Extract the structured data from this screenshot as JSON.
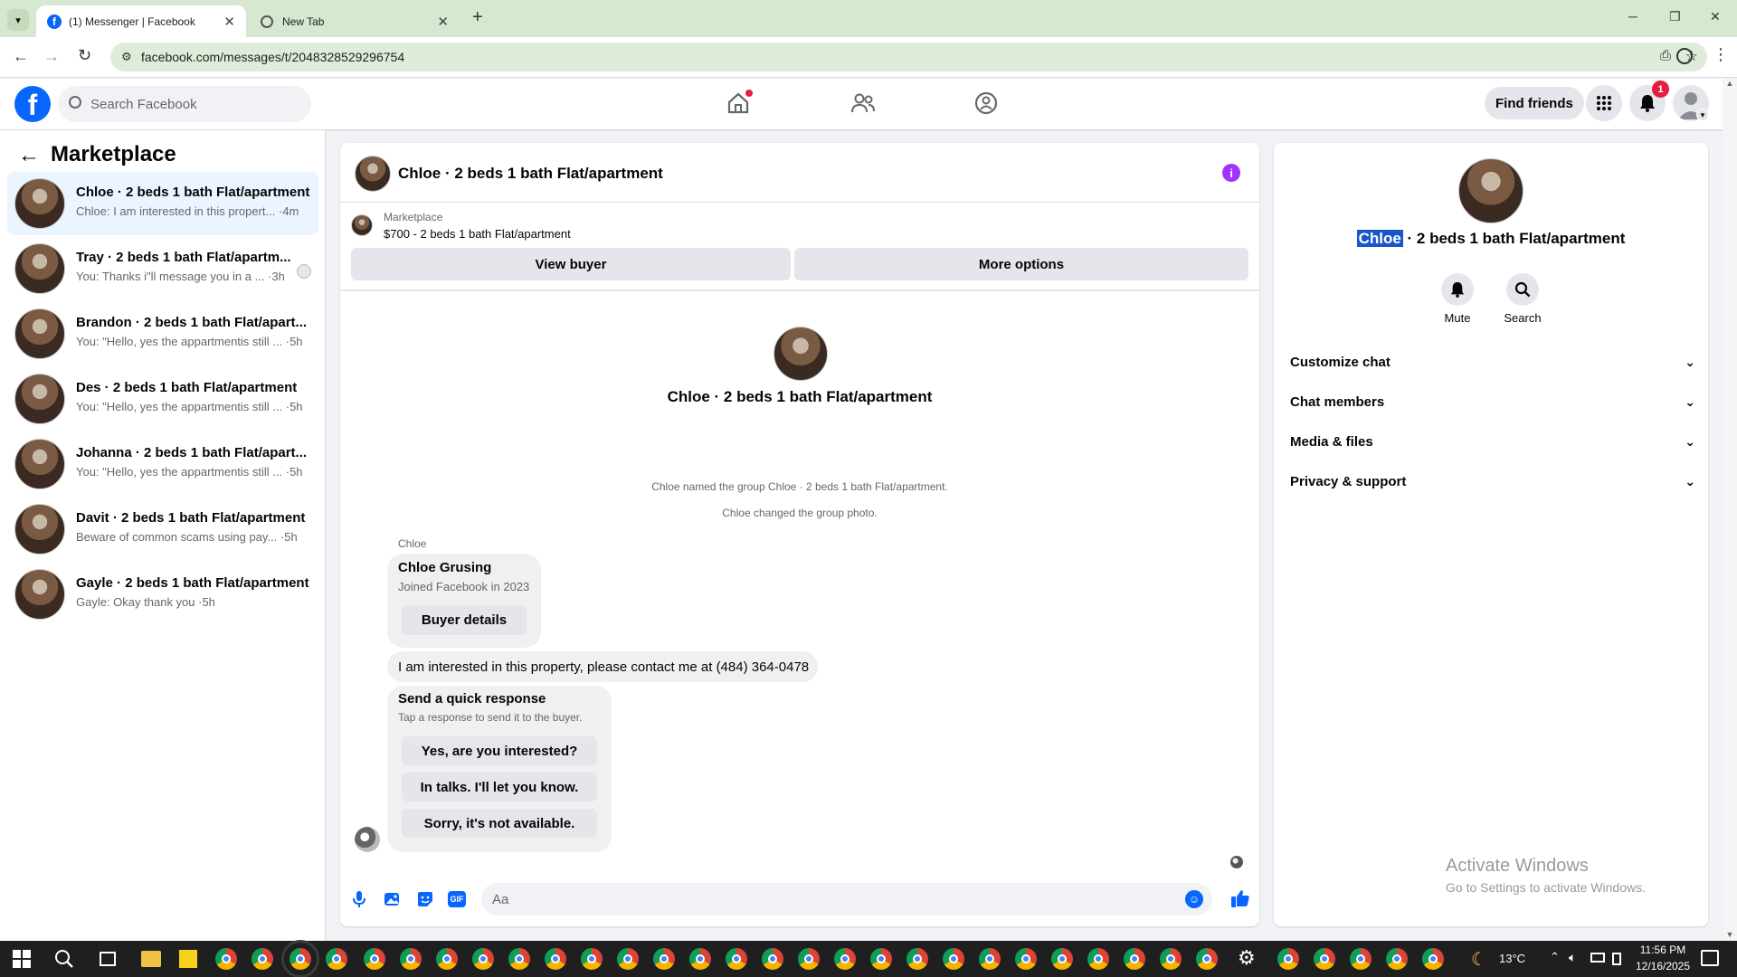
{
  "browser": {
    "tabs": [
      {
        "title": "(1) Messenger | Facebook"
      },
      {
        "title": "New Tab"
      }
    ],
    "url": "facebook.com/messages/t/2048328529296754"
  },
  "fb_header": {
    "search_placeholder": "Search Facebook",
    "find_friends": "Find friends",
    "notification_count": "1"
  },
  "sidebar": {
    "title": "Marketplace",
    "conversations": [
      {
        "title": "Chloe · 2 beds 1 bath Flat/apartment",
        "preview": "Chloe: I am interested in this propert... ·4m"
      },
      {
        "title": "Tray · 2 beds 1 bath Flat/apartm...",
        "preview": "You: Thanks i\"ll message you in a ... ·3h"
      },
      {
        "title": "Brandon · 2 beds 1 bath Flat/apart...",
        "preview": "You: \"Hello, yes the appartmentis still ... ·5h"
      },
      {
        "title": "Des · 2 beds 1 bath Flat/apartment",
        "preview": "You: \"Hello, yes the appartmentis still ... ·5h"
      },
      {
        "title": "Johanna · 2 beds 1 bath Flat/apart...",
        "preview": "You: \"Hello, yes the appartmentis still ... ·5h"
      },
      {
        "title": "Davit · 2 beds 1 bath Flat/apartment",
        "preview": "Beware of common scams using pay... ·5h"
      },
      {
        "title": "Gayle · 2 beds 1 bath Flat/apartment",
        "preview": "Gayle: Okay thank you ·5h"
      }
    ]
  },
  "chat": {
    "header_title": "Chloe · 2 beds 1 bath Flat/apartment",
    "listing_label": "Marketplace",
    "listing_title": "$700 - 2 beds 1 bath Flat/apartment",
    "view_buyer": "View buyer",
    "more_options": "More options",
    "intro_title": "Chloe · 2 beds 1 bath Flat/apartment",
    "system_messages": [
      "Chloe named the group Chloe · 2 beds 1 bath Flat/apartment.",
      "Chloe changed the group photo."
    ],
    "sender_name": "Chloe",
    "card_name": "Chloe Grusing",
    "card_sub": "Joined Facebook in 2023",
    "buyer_details": "Buyer details",
    "message": "I am interested in this property, please contact me at (484) 364-0478",
    "quick_title": "Send a quick response",
    "quick_sub": "Tap a response to send it to the buyer.",
    "quick_replies": [
      "Yes, are you interested?",
      "In talks. I'll let you know.",
      "Sorry, it's not available."
    ],
    "composer_placeholder": "Aa"
  },
  "right_panel": {
    "name_highlight": "Chloe",
    "name_rest": "· 2 beds 1 bath Flat/apartment",
    "mute": "Mute",
    "search": "Search",
    "sections": [
      "Customize chat",
      "Chat members",
      "Media & files",
      "Privacy & support"
    ]
  },
  "watermark": {
    "title": "Activate Windows",
    "sub": "Go to Settings to activate Windows."
  },
  "taskbar": {
    "temperature": "13°C",
    "time": "11:56 PM",
    "date": "12/16/2025"
  },
  "colors": {
    "fb_blue": "#0866ff",
    "accent_purple": "#a033ff",
    "chrome_green": "#d6e8cf"
  }
}
